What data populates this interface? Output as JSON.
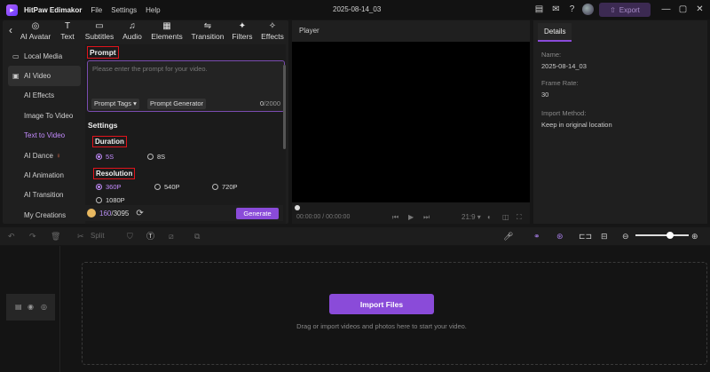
{
  "titlebar": {
    "app_name": "HitPaw Edimakor",
    "menus": [
      "File",
      "Settings",
      "Help"
    ],
    "project_name": "2025-08-14_03",
    "export_label": "Export"
  },
  "tool_tabs": [
    {
      "label": "AI Avatar",
      "icon": "ai-avatar-icon",
      "glyph": "◎"
    },
    {
      "label": "Text",
      "icon": "text-icon",
      "glyph": "T"
    },
    {
      "label": "Subtitles",
      "icon": "subtitles-icon",
      "glyph": "▭"
    },
    {
      "label": "Audio",
      "icon": "audio-icon",
      "glyph": "♫"
    },
    {
      "label": "Elements",
      "icon": "elements-icon",
      "glyph": "▦"
    },
    {
      "label": "Transition",
      "icon": "transition-icon",
      "glyph": "⇋"
    },
    {
      "label": "Filters",
      "icon": "filters-icon",
      "glyph": "✦"
    },
    {
      "label": "Effects",
      "icon": "effects-icon",
      "glyph": "✧"
    }
  ],
  "side_nav": {
    "local_media": "Local Media",
    "ai_video": "AI Video",
    "items": [
      "AI Effects",
      "Image To Video",
      "Text to Video",
      "AI Dance",
      "AI Animation",
      "AI Transition",
      "My Creations"
    ],
    "active": "Text to Video"
  },
  "prompt": {
    "label": "Prompt",
    "placeholder": "Please enter the prompt for your video.",
    "tags_label": "Prompt Tags",
    "generator_label": "Prompt Generator",
    "counter_current": "0",
    "counter_max": "/2000"
  },
  "settings": {
    "label": "Settings",
    "duration": {
      "label": "Duration",
      "options": [
        "5S",
        "8S"
      ],
      "selected": "5S"
    },
    "resolution": {
      "label": "Resolution",
      "options": [
        "360P",
        "540P",
        "720P",
        "1080P"
      ],
      "selected": "360P"
    }
  },
  "credits": {
    "used": "160",
    "total": "/3095"
  },
  "generate_label": "Generate",
  "player": {
    "title": "Player",
    "time_current": "00:00:00",
    "time_total": "00:00:00",
    "aspect": "21:9"
  },
  "details": {
    "tab": "Details",
    "name_label": "Name:",
    "name_value": "2025-08-14_03",
    "frame_rate_label": "Frame Rate:",
    "frame_rate_value": "30",
    "import_method_label": "Import Method:",
    "import_method_value": "Keep in original location"
  },
  "timeline": {
    "split_label": "Split",
    "import_label": "Import Files",
    "hint": "Drag or import videos and photos here to start your video."
  },
  "colors": {
    "accent": "#8a4bd9",
    "accent_text": "#c48cff",
    "highlight_box": "#e0131b"
  }
}
